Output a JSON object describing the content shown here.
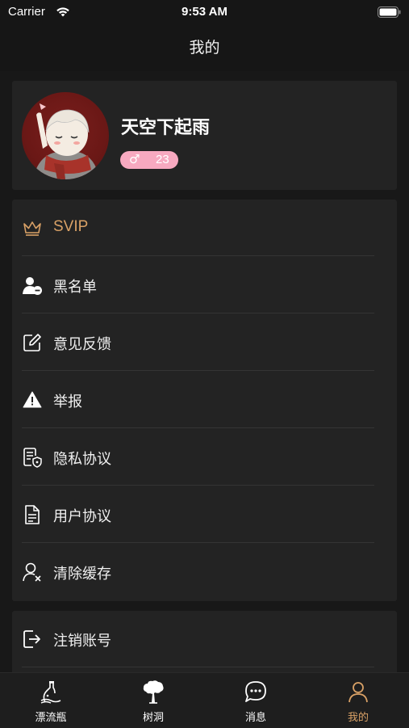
{
  "status_bar": {
    "carrier": "Carrier",
    "time": "9:53 AM"
  },
  "nav": {
    "title": "我的"
  },
  "profile": {
    "username": "天空下起雨",
    "gender_symbol": "♂",
    "age": "23"
  },
  "menu": [
    {
      "label": "SVIP",
      "icon": "crown-icon"
    },
    {
      "label": "黑名单",
      "icon": "user-block-icon"
    },
    {
      "label": "意见反馈",
      "icon": "edit-icon"
    },
    {
      "label": "举报",
      "icon": "warning-icon"
    },
    {
      "label": "隐私协议",
      "icon": "privacy-doc-icon"
    },
    {
      "label": "用户协议",
      "icon": "document-icon"
    },
    {
      "label": "清除缓存",
      "icon": "user-clear-icon"
    }
  ],
  "logout": {
    "label": "注销账号",
    "icon": "logout-icon"
  },
  "tabs": [
    {
      "label": "漂流瓶",
      "icon": "bottle-icon"
    },
    {
      "label": "树洞",
      "icon": "tree-icon"
    },
    {
      "label": "消息",
      "icon": "message-icon"
    },
    {
      "label": "我的",
      "icon": "person-icon",
      "active": true
    }
  ],
  "colors": {
    "accent": "#d9a166",
    "badge": "#f7a9c0",
    "card": "#232323",
    "background": "#181818"
  }
}
